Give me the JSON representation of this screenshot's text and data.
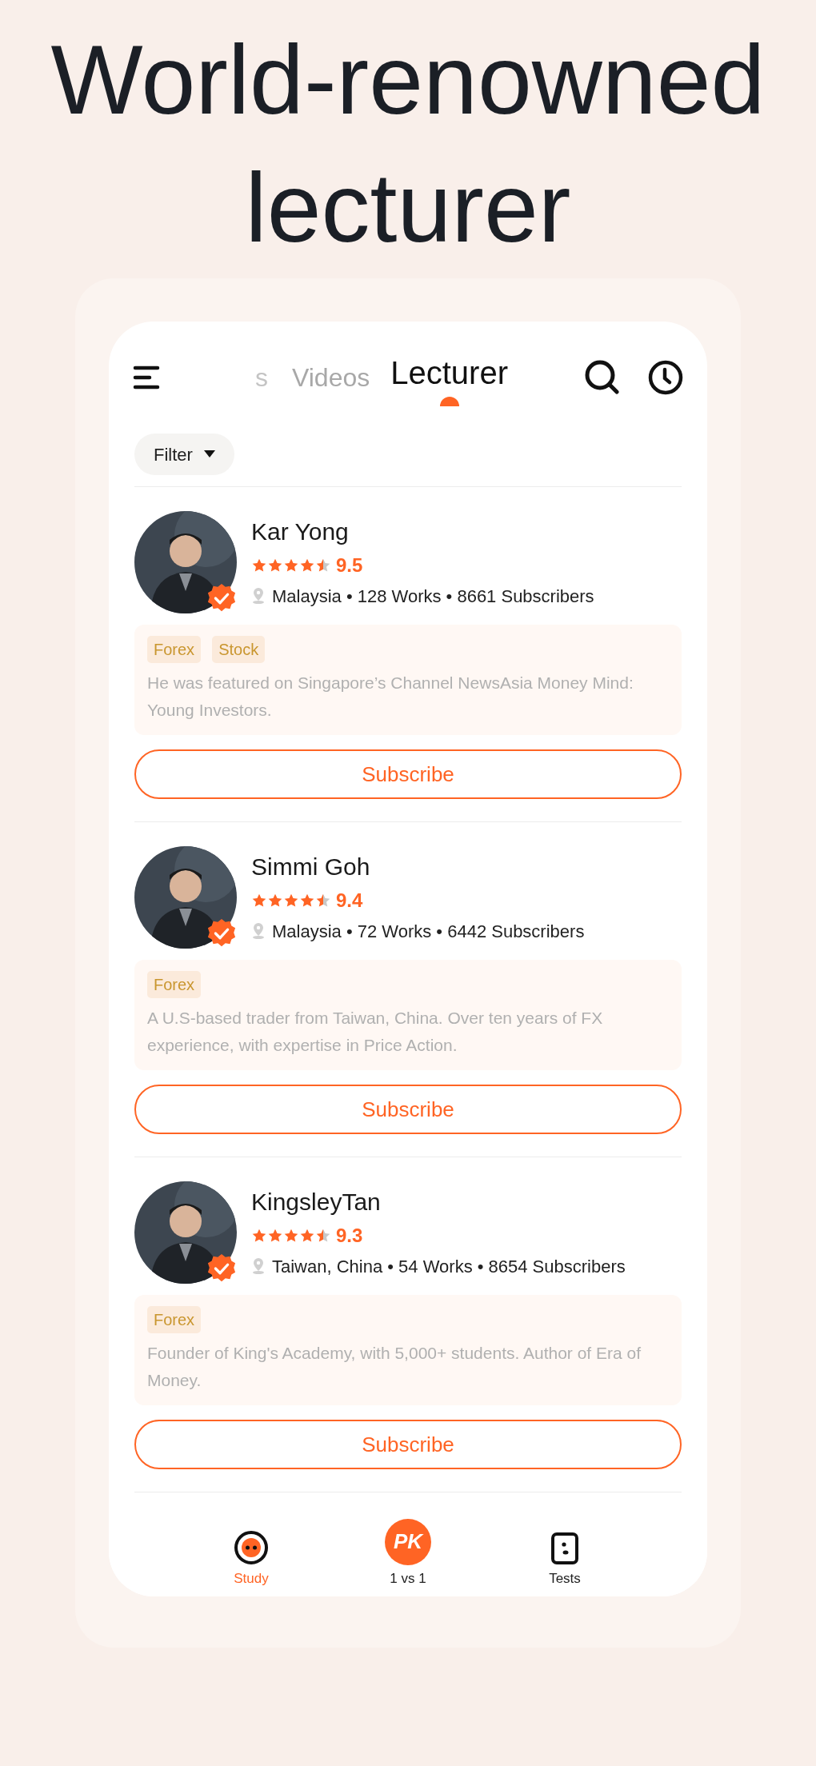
{
  "headline": "World-renowned lecturer",
  "tabs": [
    {
      "label": "s",
      "selected": false,
      "faded": true
    },
    {
      "label": "Videos",
      "selected": false,
      "faded": false
    },
    {
      "label": "Lecturer",
      "selected": true,
      "faded": false
    }
  ],
  "filter": {
    "label": "Filter"
  },
  "lecturers": [
    {
      "name": "Kar Yong",
      "stars": 4.5,
      "score": "9.5",
      "verified": true,
      "meta": "Malaysia • 128 Works • 8661 Subscribers",
      "tags": [
        "Forex",
        "Stock"
      ],
      "bio": "He was featured on Singapore’s Channel NewsAsia Money Mind: Young Investors.",
      "button": "Subscribe"
    },
    {
      "name": "Simmi Goh",
      "stars": 4.5,
      "score": "9.4",
      "verified": true,
      "meta": "Malaysia • 72 Works • 6442 Subscribers",
      "tags": [
        "Forex"
      ],
      "bio": "A U.S-based trader from Taiwan, China. Over ten years of FX experience, with expertise in Price Action.",
      "button": "Subscribe"
    },
    {
      "name": "KingsleyTan",
      "stars": 4.5,
      "score": "9.3",
      "verified": true,
      "meta": "Taiwan, China • 54 Works • 8654 Subscribers",
      "tags": [
        "Forex"
      ],
      "bio": "Founder of King's Academy, with 5,000+ students. Author of Era of Money.",
      "button": "Subscribe"
    }
  ],
  "nav": [
    {
      "kind": "study",
      "label": "Study",
      "selected": true
    },
    {
      "kind": "pk",
      "label": "1 vs 1",
      "logo": "PK",
      "selected": false
    },
    {
      "kind": "tests",
      "label": "Tests",
      "selected": false
    }
  ]
}
